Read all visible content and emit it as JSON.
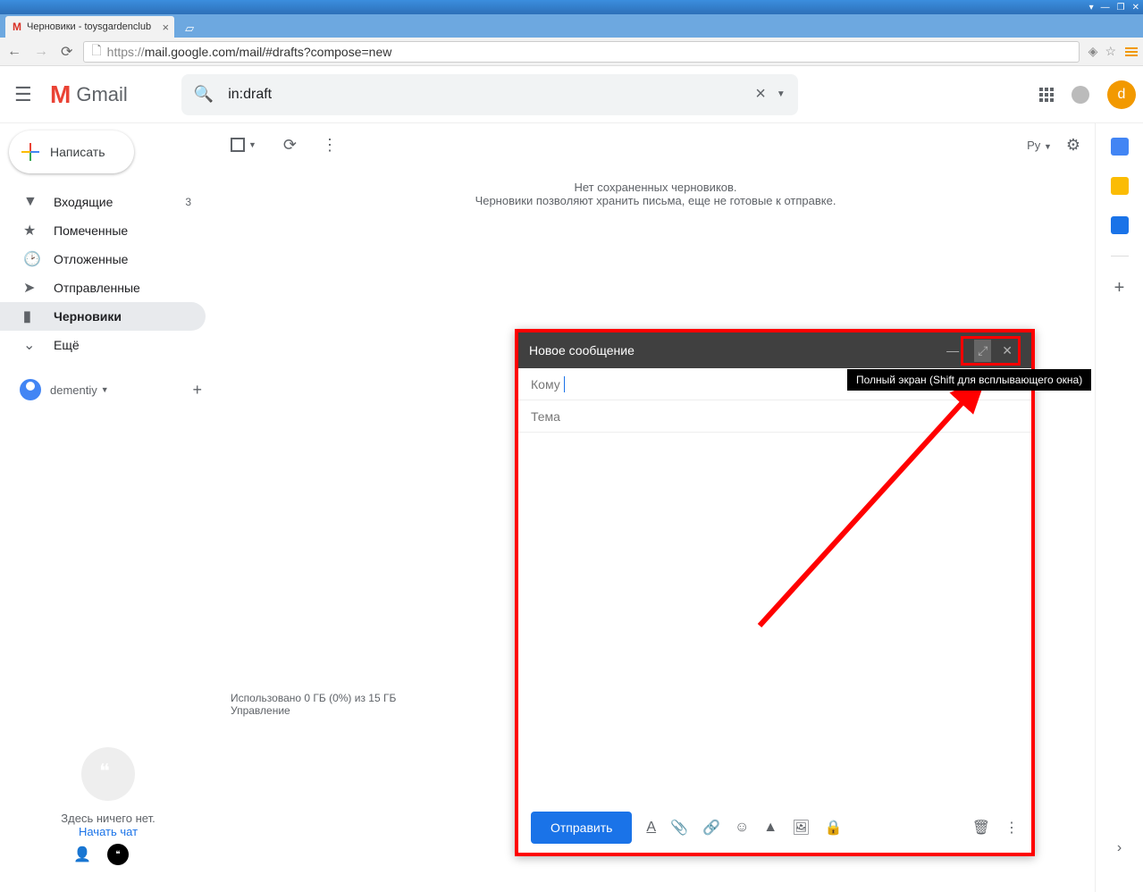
{
  "window": {
    "tab_title": "Черновики - toysgardenclub"
  },
  "browser": {
    "url": "https://mail.google.com/mail/#drafts?compose=new",
    "url_display_prefix": "https://",
    "url_display_rest": "mail.google.com/mail/#drafts?compose=new"
  },
  "header": {
    "logo_text": "Gmail",
    "search_value": "in:draft",
    "avatar_letter": "d"
  },
  "sidebar": {
    "compose": "Написать",
    "items": [
      {
        "icon": "📥",
        "label": "Входящие",
        "count": "3"
      },
      {
        "icon": "★",
        "label": "Помеченные"
      },
      {
        "icon": "🕒",
        "label": "Отложенные"
      },
      {
        "icon": "➤",
        "label": "Отправленные"
      },
      {
        "icon": "📄",
        "label": "Черновики",
        "active": true
      },
      {
        "icon": "⌄",
        "label": "Ещё"
      }
    ],
    "user": "dementiy",
    "hangouts_empty": "Здесь ничего нет.",
    "hangouts_start": "Начать чат"
  },
  "toolbar": {
    "lang": "Ру"
  },
  "empty": {
    "line1": "Нет сохраненных черновиков.",
    "line2": "Черновики позволяют хранить письма, еще не готовые к отправке."
  },
  "storage": {
    "line1": "Использовано 0 ГБ (0%) из 15 ГБ",
    "line2": "Управление"
  },
  "compose": {
    "title": "Новое сообщение",
    "to": "Кому",
    "subject": "Тема",
    "send": "Отправить"
  },
  "tooltip": "Полный экран (Shift для всплывающего окна)"
}
